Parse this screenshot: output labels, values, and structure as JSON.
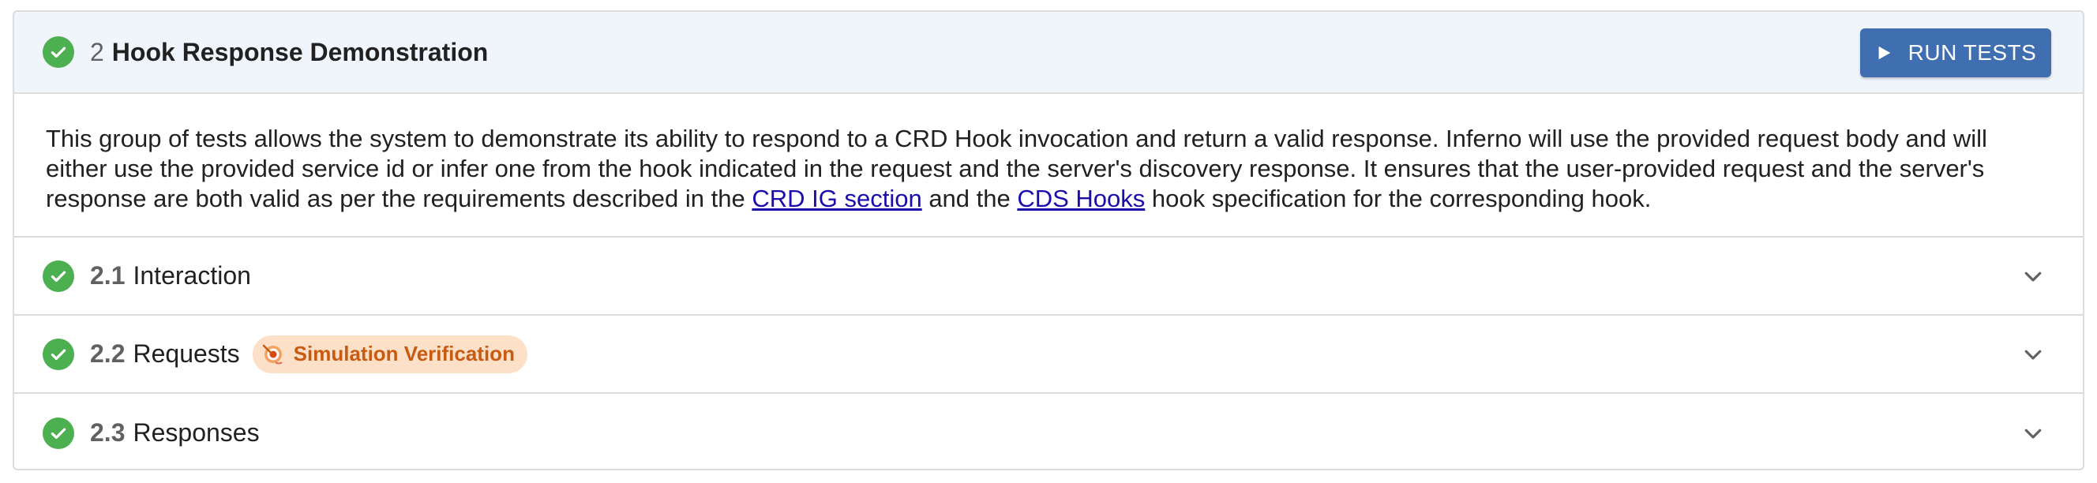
{
  "group": {
    "number": "2",
    "title": "Hook Response Demonstration",
    "run_button_label": "RUN TESTS",
    "description": {
      "part1": "This group of tests allows the system to demonstrate its ability to respond to a CRD Hook invocation and return a valid response. Inferno will use the provided request body and will either use the provided service id or infer one from the hook indicated in the request and the server's discovery response. It ensures that the user-provided request and the server's response are both valid as per the requirements described in the ",
      "link1": "CRD IG section",
      "part2": " and the ",
      "link2": "CDS Hooks",
      "part3": " hook specification for the corresponding hook."
    }
  },
  "items": [
    {
      "number": "2.1",
      "label": "Interaction"
    },
    {
      "number": "2.2",
      "label": "Requests",
      "badge": "Simulation Verification"
    },
    {
      "number": "2.3",
      "label": "Responses"
    }
  ],
  "colors": {
    "success": "#4caf50",
    "button": "#3f6fb0",
    "badge_bg": "#fce0c8",
    "badge_text": "#c85a12",
    "header_bg": "#f0f5fc"
  },
  "icons": {
    "status": "check-circle-icon",
    "run": "play-icon",
    "expand": "chevron-down-icon",
    "badge": "target-icon"
  }
}
